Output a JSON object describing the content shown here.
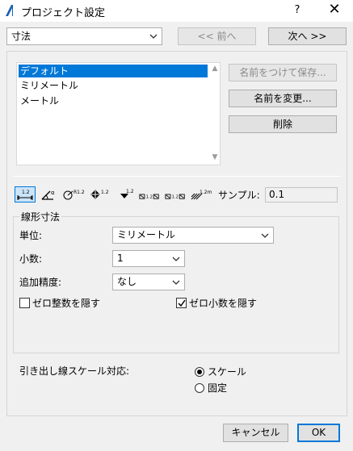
{
  "window": {
    "title": "プロジェクト設定",
    "help_label": "?",
    "close_label": "✕"
  },
  "top": {
    "section_select": "寸法",
    "prev_label": "<< 前へ",
    "next_label": "次へ >>"
  },
  "presets": {
    "items": [
      "デフォルト",
      "ミリメートル",
      "メートル"
    ],
    "selected_index": 0,
    "save_as_label": "名前をつけて保存...",
    "rename_label": "名前を変更...",
    "delete_label": "削除"
  },
  "toolbar": {
    "tools": [
      "linear-dimension",
      "angle-dimension",
      "radial-dimension",
      "level-dimension",
      "elevation-dimension",
      "door-window-dimension",
      "sill-height-dimension",
      "area-dimension"
    ],
    "active_index": 0,
    "sample_label": "サンプル:",
    "sample_value": "0.1"
  },
  "linear": {
    "group_title": "線形寸法",
    "unit_label": "単位:",
    "unit_value": "ミリメートル",
    "decimals_label": "小数:",
    "decimals_value": "1",
    "extra_accuracy_label": "追加精度:",
    "extra_accuracy_value": "なし",
    "hide_zero_integer_label": "ゼロ整数を隠す",
    "hide_zero_integer_checked": false,
    "hide_zero_decimal_label": "ゼロ小数を隠す",
    "hide_zero_decimal_checked": true
  },
  "leader": {
    "label": "引き出し線スケール対応:",
    "options": [
      "スケール",
      "固定"
    ],
    "selected_index": 0
  },
  "footer": {
    "cancel_label": "キャンセル",
    "ok_label": "OK"
  }
}
